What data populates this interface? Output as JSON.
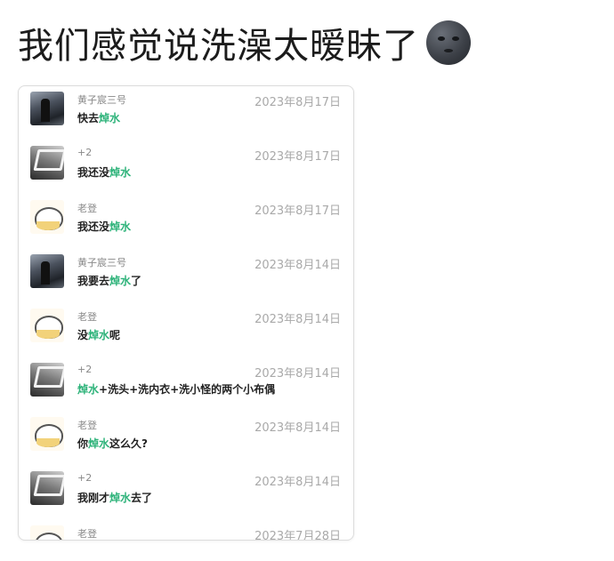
{
  "post": {
    "headline": "我们感觉说洗澡太暧昧了",
    "emoji": "new-moon-face-emoji"
  },
  "colors": {
    "keyword": "#2eb37a",
    "date": "#a9a9a9",
    "name": "#888888"
  },
  "messages": [
    {
      "name": "黄子宸三号",
      "date": "2023年8月17日",
      "avatar": "dark-figure-avatar",
      "pre": "快去",
      "kw": "焯水",
      "post": ""
    },
    {
      "name": "+2",
      "date": "2023年8月17日",
      "avatar": "grey-sketch-avatar",
      "pre": "我还没",
      "kw": "焯水",
      "post": ""
    },
    {
      "name": "老登",
      "date": "2023年8月17日",
      "avatar": "cat-avatar",
      "pre": "我还没",
      "kw": "焯水",
      "post": ""
    },
    {
      "name": "黄子宸三号",
      "date": "2023年8月14日",
      "avatar": "dark-figure-avatar",
      "pre": "我要去",
      "kw": "焯水",
      "post": "了"
    },
    {
      "name": "老登",
      "date": "2023年8月14日",
      "avatar": "cat-avatar",
      "pre": "没",
      "kw": "焯水",
      "post": "呢"
    },
    {
      "name": "+2",
      "date": "2023年8月14日",
      "avatar": "grey-sketch-avatar",
      "pre": "",
      "kw": "焯水",
      "post": "+洗头+洗内衣+洗小怪的两个小布偶"
    },
    {
      "name": "老登",
      "date": "2023年8月14日",
      "avatar": "cat-avatar",
      "pre": "你",
      "kw": "焯水",
      "post": "这么久?"
    },
    {
      "name": "+2",
      "date": "2023年8月14日",
      "avatar": "grey-sketch-avatar",
      "pre": "我刚才",
      "kw": "焯水",
      "post": "去了"
    },
    {
      "name": "老登",
      "date": "2023年7月28日",
      "avatar": "cat-avatar",
      "pre": "",
      "kw": "",
      "post": ""
    }
  ]
}
